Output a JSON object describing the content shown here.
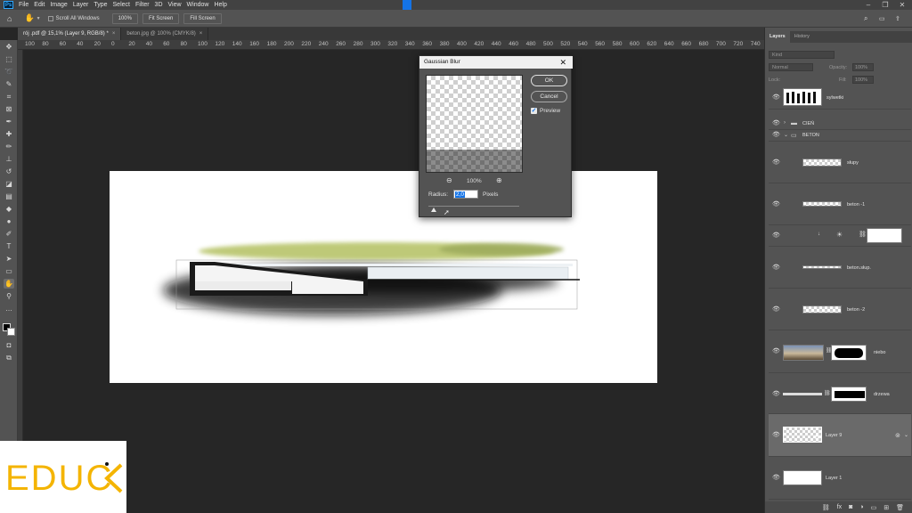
{
  "menubar": {
    "items": [
      "File",
      "Edit",
      "Image",
      "Layer",
      "Type",
      "Select",
      "Filter",
      "3D",
      "View",
      "Window",
      "Help"
    ]
  },
  "options": {
    "scroll_all_windows": "Scroll All Windows",
    "zoom_100": "100%",
    "fit_screen": "Fit Screen",
    "fill_screen": "Fill Screen"
  },
  "tabs": [
    {
      "label": "rój .pdf @ 15,1% (Layer 9, RGB/8) *",
      "active": true
    },
    {
      "label": "beton.jpg @ 100% (CMYK/8)",
      "active": false
    }
  ],
  "ruler": {
    "labels": [
      "100",
      "80",
      "60",
      "40",
      "20",
      "0",
      "20",
      "40",
      "60",
      "80",
      "100",
      "120",
      "140",
      "160",
      "180",
      "200",
      "220",
      "240",
      "260",
      "280",
      "300",
      "320",
      "340",
      "360",
      "380",
      "400",
      "420",
      "440",
      "460",
      "480",
      "500",
      "520",
      "540",
      "560",
      "580",
      "600",
      "620",
      "640",
      "660",
      "680",
      "700",
      "720",
      "740"
    ]
  },
  "dialog": {
    "title": "Gaussian Blur",
    "ok": "OK",
    "cancel": "Cancel",
    "preview_label": "Preview",
    "zoom": "100%",
    "radius_label": "Radius:",
    "radius_value": "2,0",
    "radius_unit": "Pixels",
    "slider_position": 0.06
  },
  "panels": {
    "tabs": [
      "Layers",
      "History"
    ],
    "search_placeholder": "Kind",
    "blend_mode": "Normal",
    "opacity_label": "Opacity:",
    "opacity_value": "100%",
    "lock_label": "Lock:",
    "fill_label": "Fill:",
    "fill_value": "100%",
    "layers": [
      {
        "name": "sylwetki"
      },
      {
        "name": "CIEŃ"
      },
      {
        "name": "BETON"
      },
      {
        "name": "słupy"
      },
      {
        "name": "beton -1"
      },
      {
        "name": ""
      },
      {
        "name": "beton.słup."
      },
      {
        "name": "beton -2"
      },
      {
        "name": "niebo"
      },
      {
        "name": "drzewa"
      },
      {
        "name": "Layer 9"
      },
      {
        "name": "Layer 1"
      }
    ]
  },
  "logo": {
    "text": "EDUC"
  },
  "colors": {
    "accent": "#31a8ff",
    "logo": "#f4b400",
    "dialog_bg": "#535353"
  }
}
